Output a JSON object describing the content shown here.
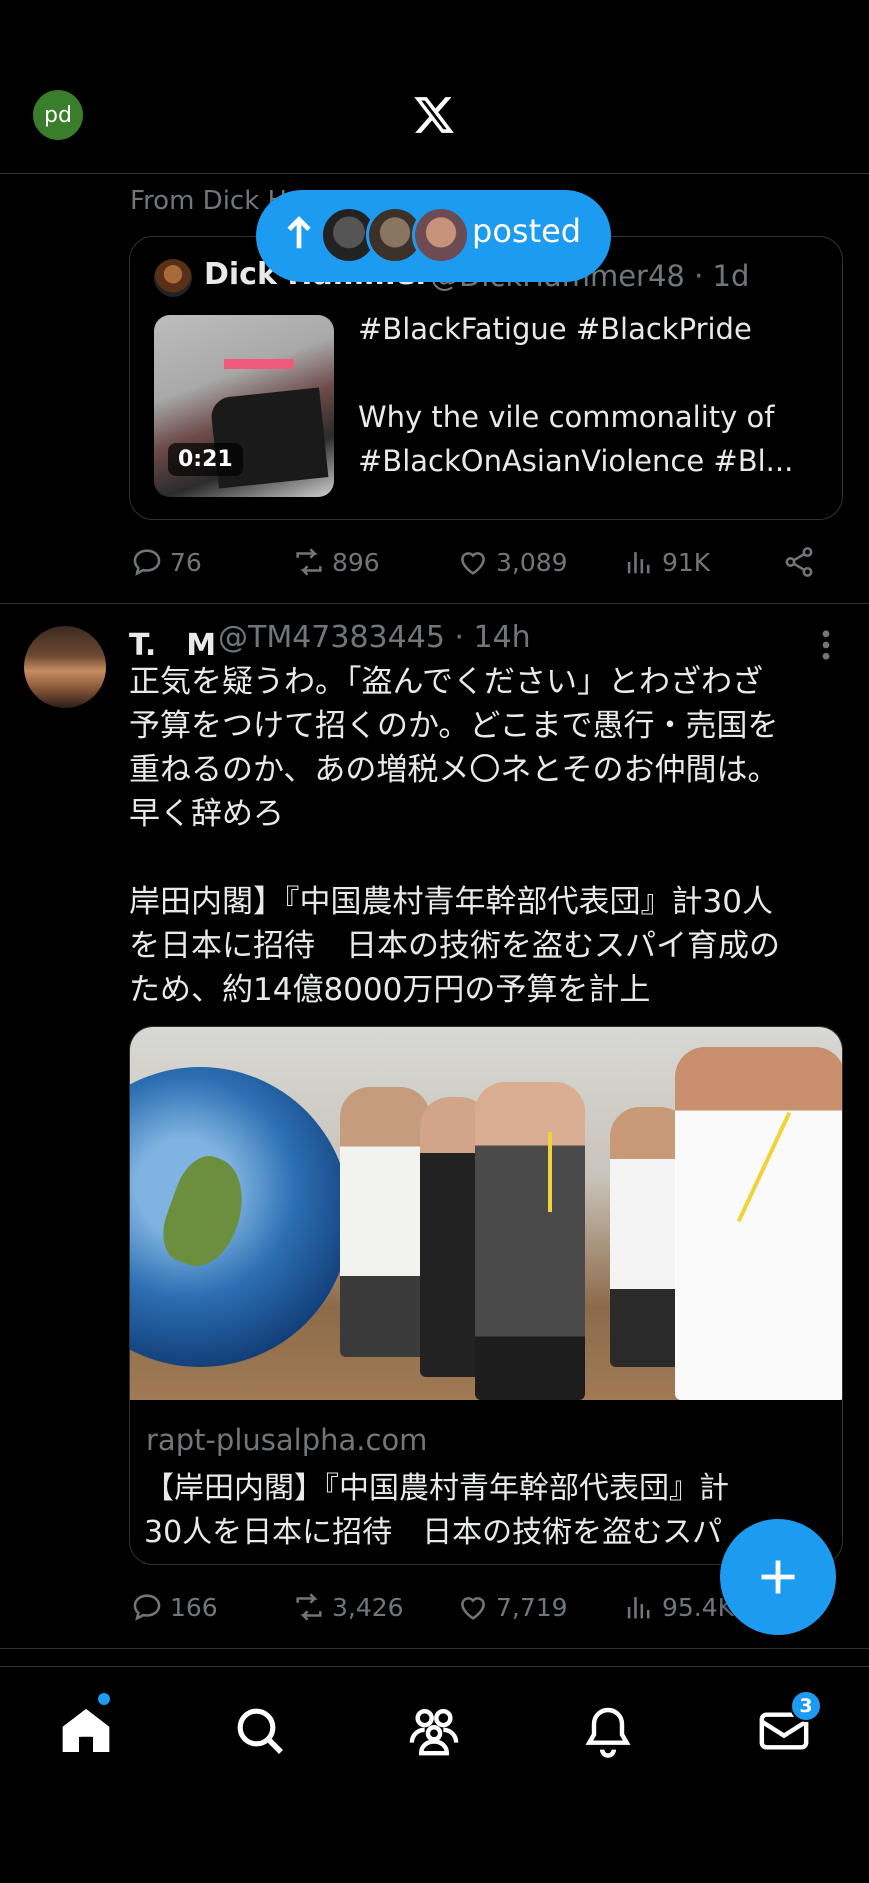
{
  "header": {
    "avatar_initials": "pd",
    "logo": "x-logo"
  },
  "posted_pill": {
    "label": "posted"
  },
  "tweet1": {
    "context_line": "From Dick H",
    "quote": {
      "author_name": "Dick Hammer",
      "author_handle": "@DickHammer48 · 1d",
      "video_duration": "0:21",
      "text_lines": [
        "#BlackFatigue #BlackPride",
        "",
        "Why the vile commonality of",
        "#BlackOnAsianViolence #Bl..."
      ]
    },
    "stats": {
      "replies": "76",
      "reposts": "896",
      "likes": "3,089",
      "views": "91K"
    }
  },
  "tweet2": {
    "author_name": "T.　M",
    "author_handle": "@TM47383445 · 14h",
    "body_lines": [
      "正気を疑うわ。「盗んでください」とわざわざ",
      "予算をつけて招くのか。どこまで愚行・売国を",
      "重ねるのか、あの増税メ〇ネとそのお仲間は。",
      "早く辞めろ",
      "",
      "岸田内閣】『中国農村青年幹部代表団』計30人",
      "を日本に招待　日本の技術を盗むスパイ育成の",
      "ため、約14億8000万円の予算を計上"
    ],
    "link_card": {
      "domain": "rapt-plusalpha.com",
      "title_lines": [
        "【岸田内閣】『中国農村青年幹部代表団』計",
        "30人を日本に招待　日本の技術を盗むスパ"
      ]
    },
    "stats": {
      "replies": "166",
      "reposts": "3,426",
      "likes": "7,719",
      "views": "95.4K"
    }
  },
  "bottom_nav": {
    "items": [
      "home-icon",
      "search-icon",
      "communities-icon",
      "notifications-icon",
      "messages-icon"
    ],
    "messages_badge": "3"
  },
  "colors": {
    "accent": "#1d9bf0",
    "background": "#000000",
    "text": "#e7e9ea",
    "muted": "#71767b",
    "border": "#2f3336"
  }
}
